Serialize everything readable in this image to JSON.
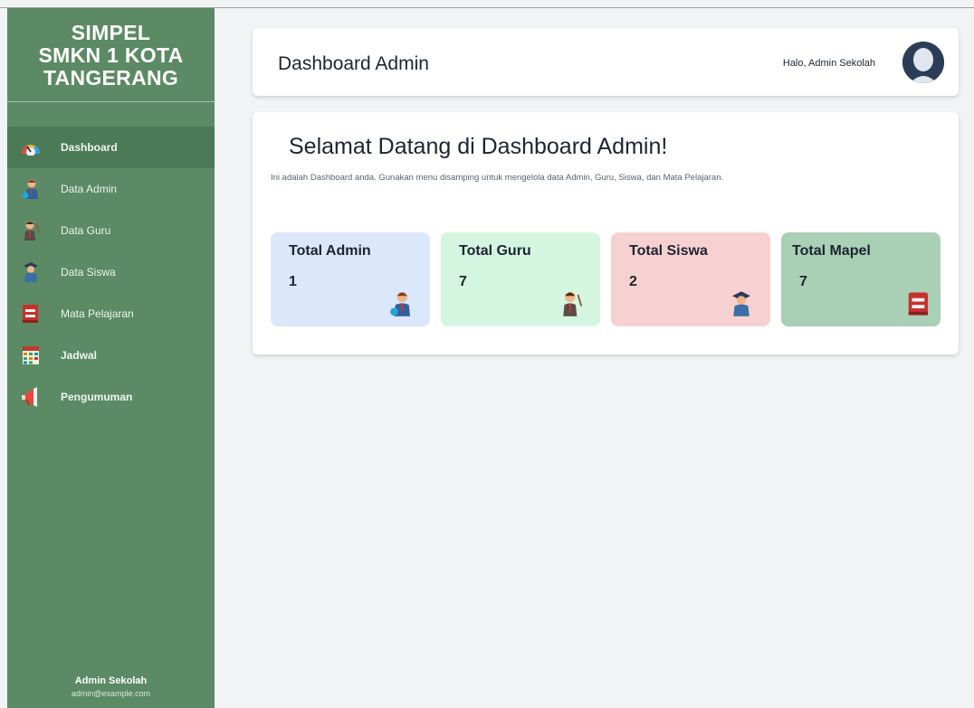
{
  "app": {
    "brand_line1": "SIMPEL",
    "brand_line2": "SMKN 1 KOTA",
    "brand_line3": "TANGERANG"
  },
  "sidebar": {
    "items": [
      {
        "label": "Dashboard",
        "icon": "dashboard-gauge-icon",
        "active": true
      },
      {
        "label": "Data Admin",
        "icon": "admin-user-icon"
      },
      {
        "label": "Data Guru",
        "icon": "teacher-icon"
      },
      {
        "label": "Data Siswa",
        "icon": "student-icon"
      },
      {
        "label": "Mata Pelajaran",
        "icon": "book-icon"
      },
      {
        "label": "Jadwal",
        "icon": "calendar-icon"
      },
      {
        "label": "Pengumuman",
        "icon": "megaphone-icon"
      }
    ],
    "footer_name": "Admin Sekolah",
    "footer_email": "admin@example.com"
  },
  "header": {
    "title": "Dashboard Admin",
    "greeting": "Halo, Admin Sekolah",
    "avatar_icon": "user-avatar-icon"
  },
  "main": {
    "welcome": "Selamat Datang di Dashboard Admin!",
    "description": "Ini adalah Dashboard anda. Gunakan menu disamping untuk mengelola data Admin, Guru, Siswa, dan Mata Pelajaran.",
    "stats": [
      {
        "label": "Total Admin",
        "value": "1",
        "color": "#dbe7fb",
        "icon": "admin-user-icon"
      },
      {
        "label": "Total Guru",
        "value": "7",
        "color": "#d4f5e0",
        "icon": "teacher-icon"
      },
      {
        "label": "Total Siswa",
        "value": "2",
        "color": "#f7d1d1",
        "icon": "student-icon"
      },
      {
        "label": "Total Mapel",
        "value": "7",
        "color": "#a9cfb5",
        "icon": "book-icon"
      }
    ]
  },
  "colors": {
    "sidebar": "#5b8a64",
    "sidebar_active": "#4d7a56",
    "background": "#f2f3f5"
  }
}
